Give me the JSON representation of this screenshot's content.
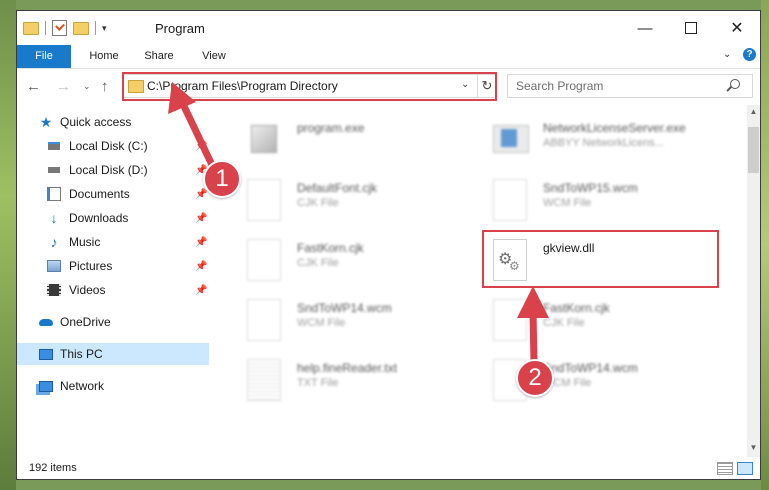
{
  "window": {
    "title": "Program",
    "controls": {
      "minimize": "—",
      "maximize": "",
      "close": "✕"
    }
  },
  "ribbon": {
    "tabs": [
      "File",
      "Home",
      "Share",
      "View"
    ],
    "help": "?"
  },
  "nav": {
    "address": "C:\\Program Files\\Program Directory",
    "search_placeholder": "Search Program"
  },
  "sidebar": {
    "items": [
      {
        "label": "Quick access",
        "icon": "star-icon",
        "pinned": false
      },
      {
        "label": "Local Disk (C:)",
        "icon": "drive-icon",
        "pinned": true
      },
      {
        "label": "Local Disk (D:)",
        "icon": "drive-icon",
        "pinned": true
      },
      {
        "label": "Documents",
        "icon": "documents-icon",
        "pinned": true
      },
      {
        "label": "Downloads",
        "icon": "download-icon",
        "pinned": true
      },
      {
        "label": "Music",
        "icon": "music-icon",
        "pinned": true
      },
      {
        "label": "Pictures",
        "icon": "pictures-icon",
        "pinned": true
      },
      {
        "label": "Videos",
        "icon": "videos-icon",
        "pinned": true
      },
      {
        "label": "OneDrive",
        "icon": "cloud-icon",
        "pinned": false
      },
      {
        "label": "This PC",
        "icon": "computer-icon",
        "pinned": false
      },
      {
        "label": "Network",
        "icon": "network-icon",
        "pinned": false
      }
    ]
  },
  "files": [
    {
      "name": "program.exe",
      "type": ""
    },
    {
      "name": "NetworkLicenseServer.exe",
      "type": "ABBYY NetworkLicens..."
    },
    {
      "name": "DefaultFont.cjk",
      "type": "CJK File"
    },
    {
      "name": "SndToWP15.wcm",
      "type": "WCM File"
    },
    {
      "name": "FastKorn.cjk",
      "type": "CJK File"
    },
    {
      "name": "gkview.dll",
      "type": ""
    },
    {
      "name": "SndToWP14.wcm",
      "type": "WCM File"
    },
    {
      "name": "FastKorn.cjk",
      "type": "CJK File"
    },
    {
      "name": "help.fineReader.txt",
      "type": "TXT File"
    },
    {
      "name": "SndToWP14.wcm",
      "type": "WCM File"
    }
  ],
  "status": {
    "item_count": "192 items"
  },
  "annotations": {
    "callout_1": "1",
    "callout_2": "2",
    "color": "#d9414b"
  }
}
